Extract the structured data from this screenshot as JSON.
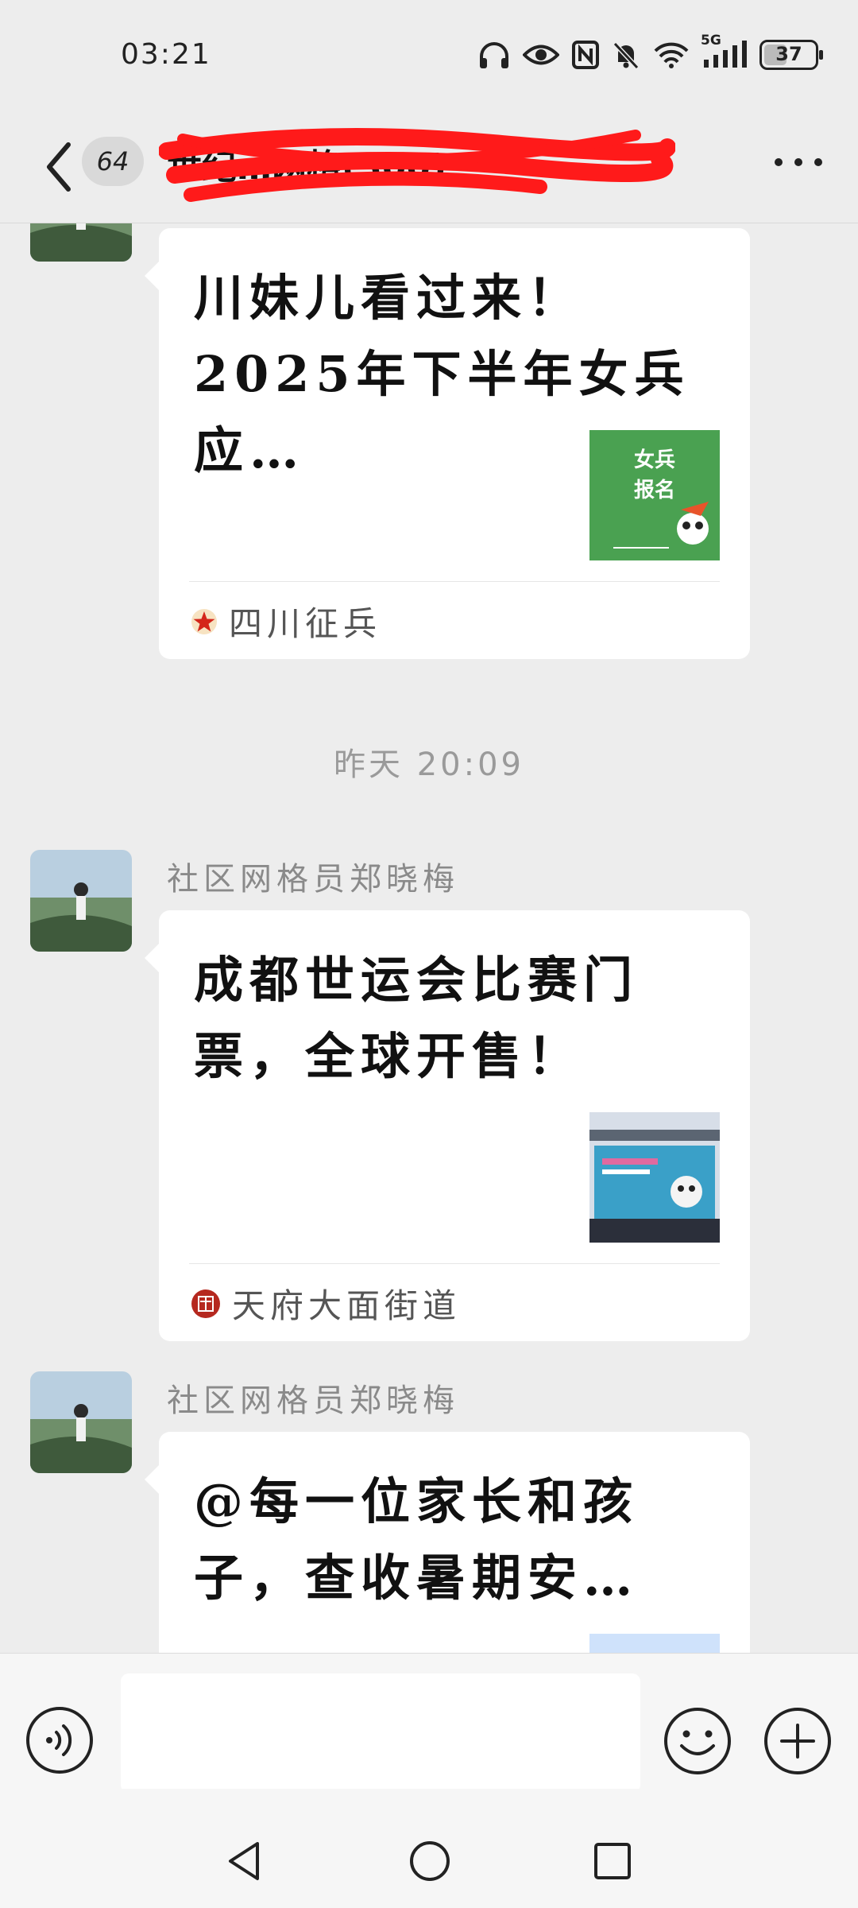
{
  "status_bar": {
    "time": "03:21",
    "network": "5G",
    "battery": "37"
  },
  "header": {
    "unread_count": "64",
    "title": "世纪…网格(300)"
  },
  "timestamp": "昨天 20:09",
  "messages": [
    {
      "sender": "",
      "title": "川妹儿看过来！2025年下半年女兵应…",
      "thumb_text": "女兵\n报名",
      "source": "四川征兵"
    },
    {
      "sender": "社区网格员郑晓梅",
      "title": "成都世运会比赛门票，全球开售！",
      "thumb_text": "",
      "source": "天府大面街道"
    },
    {
      "sender": "社区网格员郑晓梅",
      "title": "@每一位家长和孩子，查收暑期安…",
      "thumb_text": "",
      "source": ""
    }
  ],
  "colors": {
    "background": "#ededed",
    "card": "#ffffff",
    "sender": "#8a8a8a",
    "scribble": "#ff1a1a",
    "thumb_green": "#4aa151"
  }
}
